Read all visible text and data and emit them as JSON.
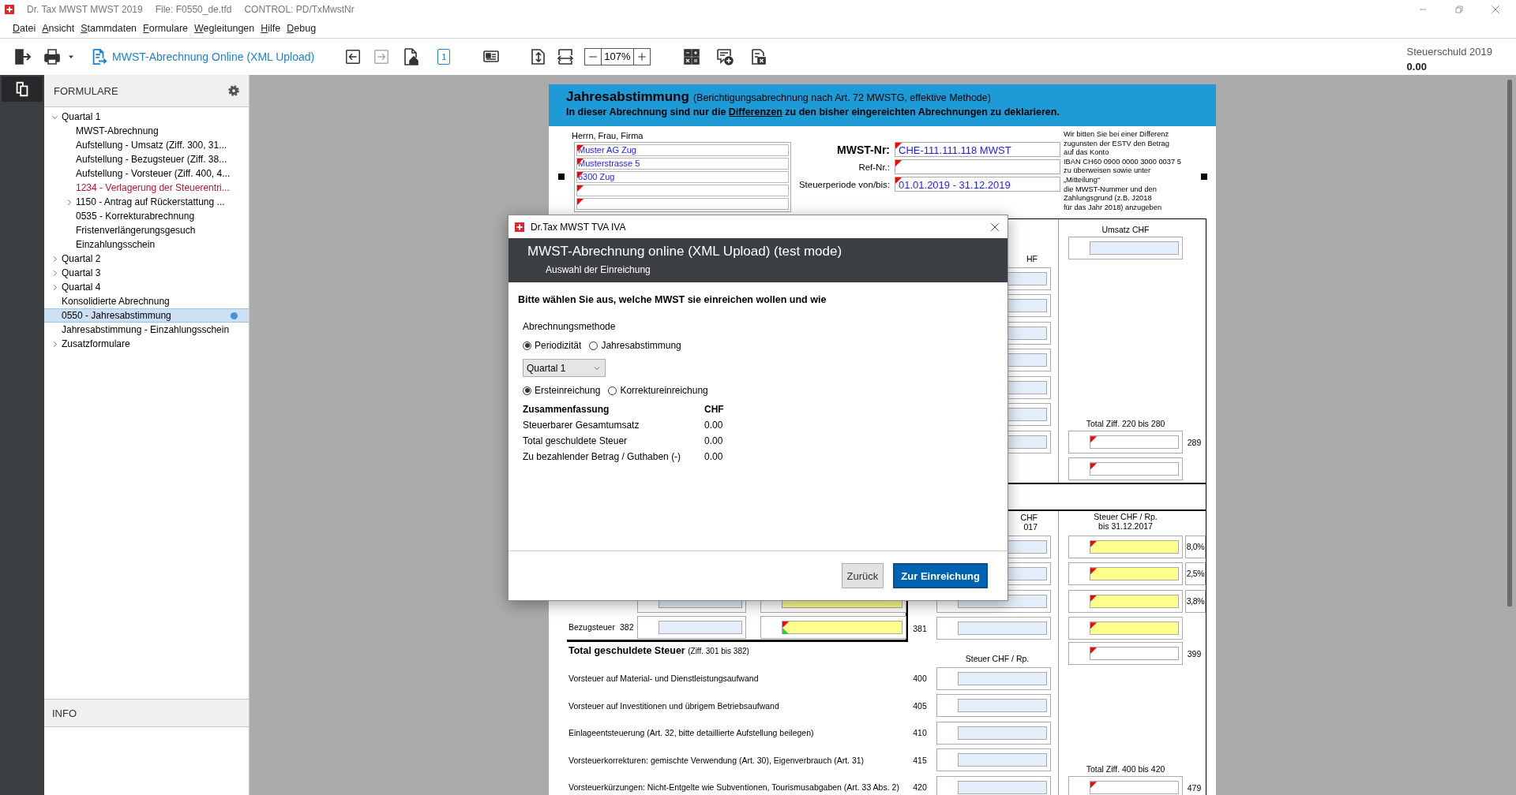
{
  "titlebar": {
    "app": "Dr. Tax MWST MWST 2019",
    "file": "File: F0550_de.tfd",
    "control": "CONTROL: PD/TxMwstNr"
  },
  "menu": [
    "Datei",
    "Ansicht",
    "Stammdaten",
    "Formulare",
    "Wegleitungen",
    "Hilfe",
    "Debug"
  ],
  "toolbar": {
    "upload_label": "MWST-Abrechnung Online (XML Upload)",
    "back_disabled": false,
    "forward_disabled": true,
    "page": "1",
    "zoom": "107%"
  },
  "tax_due": {
    "label": "Steuerschuld 2019",
    "value": "0.00"
  },
  "sidebar": {
    "title": "FORMULARE",
    "info_title": "INFO",
    "tree": [
      {
        "label": "Quartal 1",
        "expanded": true,
        "selected": false,
        "invalid": false,
        "marked": false,
        "children": [
          {
            "label": "MWST-Abrechnung",
            "selected": false,
            "invalid": false,
            "marked": false
          },
          {
            "label": "Aufstellung - Umsatz (Ziff. 300, 31...",
            "selected": false,
            "invalid": false,
            "marked": false
          },
          {
            "label": "Aufstellung - Bezugsteuer (Ziff. 38...",
            "selected": false,
            "invalid": false,
            "marked": false
          },
          {
            "label": "Aufstellung - Vorsteuer (Ziff. 400, 4...",
            "selected": false,
            "invalid": false,
            "marked": false
          },
          {
            "label": "1234 - Verlagerung der Steuerentri...",
            "selected": false,
            "invalid": true,
            "marked": false
          },
          {
            "label": "1150 - Antrag auf Rückerstattung ...",
            "expanded": false,
            "selected": false,
            "invalid": false,
            "marked": false
          },
          {
            "label": "0535 - Korrekturabrechnung",
            "selected": false,
            "invalid": false,
            "marked": false
          },
          {
            "label": "Fristenverlängerungsgesuch",
            "selected": false,
            "invalid": false,
            "marked": false
          },
          {
            "label": "Einzahlungsschein",
            "selected": false,
            "invalid": false,
            "marked": false
          }
        ]
      },
      {
        "label": "Quartal 2",
        "expanded": false,
        "selected": false,
        "invalid": false,
        "marked": false
      },
      {
        "label": "Quartal 3",
        "expanded": false,
        "selected": false,
        "invalid": false,
        "marked": false
      },
      {
        "label": "Quartal 4",
        "expanded": false,
        "selected": false,
        "invalid": false,
        "marked": false
      },
      {
        "label": "Konsolidierte Abrechnung",
        "selected": false,
        "invalid": false,
        "marked": false
      },
      {
        "label": "0550 - Jahresabstimmung",
        "selected": true,
        "invalid": false,
        "marked": true
      },
      {
        "label": "Jahresabstimmung - Einzahlungsschein",
        "selected": false,
        "invalid": false,
        "marked": false
      },
      {
        "label": "Zusatzformulare",
        "expanded": false,
        "selected": false,
        "invalid": false,
        "marked": false
      }
    ]
  },
  "document": {
    "title": "Jahresabstimmung",
    "subtitle": "(Berichtigungsabrechnung nach Art. 72 MWSTG, effektive Methode)",
    "notice": [
      "In dieser Abrechnung sind nur die ",
      "Differenzen",
      " zu den bisher eingereichten Abrechnungen zu deklarieren."
    ],
    "address_label": "Herrn, Frau, Firma",
    "address_fields": [
      {
        "value": "Muster AG Zug",
        "flagged": true
      },
      {
        "value": "Musterstrasse 5",
        "flagged": true
      },
      {
        "value": "6300 Zug",
        "flagged": true
      },
      {
        "flagged": true
      },
      {
        "flagged": true
      }
    ],
    "id_fields": [
      {
        "label": "MWST-Nr:",
        "strong": true,
        "value": "CHE-111.111.118 MWST",
        "flagged": true
      },
      {
        "label": "Ref-Nr.:",
        "strong": false,
        "flagged": true
      },
      {
        "label": "Steuerperiode von/bis:",
        "strong": false,
        "value": "01.01.2019 - 31.12.2019",
        "flagged": true
      }
    ],
    "payment_note": [
      "Wir bitten Sie bei einer Differenz",
      "zugunsten der ESTV den Betrag",
      "auf das Konto",
      "IBAN CH60 0900 0000 3000 0037 5",
      "zu überweisen sowie unter",
      "„Mitteilung“",
      "die MWST-Nummer und den",
      "Zahlungsgrund (z.B. J2018",
      "für das Jahr 2018) anzugeben"
    ],
    "sections": [
      {
        "rows": [
          {
            "mid_header": [
              "HF"
            ],
            "right_header": [
              "Umsatz CHF"
            ],
            "right": {
              "kind": "entry",
              "flagged": false
            }
          },
          {
            "mid": {
              "kind": "entry",
              "flagged": false
            }
          },
          {
            "mid": {
              "kind": "entry",
              "flagged": false
            }
          },
          {
            "mid": {
              "kind": "entry",
              "flagged": false
            }
          },
          {
            "mid": {
              "kind": "entry",
              "flagged": false
            }
          },
          {
            "mid": {
              "kind": "entry",
              "flagged": false
            }
          },
          {
            "mid": {
              "kind": "entry",
              "flagged": false
            }
          },
          {
            "mid": {
              "kind": "entry",
              "flagged": false
            },
            "right_header": [
              "Total Ziff. 220 bis 280"
            ],
            "right": {
              "kind": "total",
              "flagged": true
            },
            "rnum": "289"
          },
          {
            "right": {
              "kind": "total",
              "flagged": true
            }
          }
        ]
      },
      {
        "rows": [
          {
            "mid_header": [
              "CHF",
              "017"
            ],
            "right_header": [
              "Steuer CHF / Rp.",
              "bis 31.12.2017"
            ]
          },
          {
            "mid": {
              "kind": "entry",
              "flagged": false
            },
            "right": {
              "kind": "computed",
              "flagged": true
            },
            "pct": "8,0%"
          },
          {
            "mid": {
              "kind": "entry",
              "flagged": false
            },
            "right": {
              "kind": "computed",
              "flagged": true
            },
            "pct": "2,5%"
          },
          {
            "lfields": [
              {
                "kind": "entry",
                "flagged": false
              },
              {
                "kind": "computed",
                "flagged": false
              }
            ],
            "mid": {
              "kind": "entry",
              "flagged": false
            },
            "right": {
              "kind": "computed",
              "flagged": true
            },
            "pct": "3,8%"
          },
          {
            "label": "Bezugsteuer",
            "lnum": "382",
            "lfields": [
              {
                "kind": "entry",
                "flagged": false
              },
              {
                "kind": "computed",
                "flagged": true,
                "confirmed": true
              }
            ],
            "num": "381",
            "mid": {
              "kind": "entry",
              "flagged": false
            },
            "right": {
              "kind": "computed",
              "flagged": true
            }
          },
          {
            "label": "Total geschuldete Steuer",
            "note": "(Ziff. 301 bis 382)",
            "strong": true,
            "mid_header": [
              "Steuer CHF / Rp."
            ],
            "right": {
              "kind": "total",
              "flagged": true
            },
            "rnum": "399"
          },
          {
            "label": "Vorsteuer auf Material- und Dienstleistungsaufwand",
            "strong": false,
            "num": "400",
            "mid": {
              "kind": "entry",
              "flagged": false
            }
          },
          {
            "label": "Vorsteuer auf Investitionen und übrigem Betriebsaufwand",
            "strong": false,
            "num": "405",
            "mid": {
              "kind": "entry",
              "flagged": false
            }
          },
          {
            "label": "Einlageentsteuerung (Art. 32, bitte detaillierte Aufstellung beilegen)",
            "strong": false,
            "num": "410",
            "mid": {
              "kind": "entry",
              "flagged": false
            }
          },
          {
            "label": "Vorsteuerkorrekturen: gemischte Verwendung (Art. 30), Eigenverbrauch (Art. 31)",
            "strong": false,
            "num": "415",
            "mid": {
              "kind": "entry",
              "flagged": false
            }
          },
          {
            "label": "Vorsteuerkürzungen: Nicht-Entgelte wie Subventionen, Tourismusabgaben (Art. 33 Abs. 2)",
            "strong": false,
            "num": "420",
            "mid": {
              "kind": "entry",
              "flagged": false
            },
            "right_header": [
              "Total Ziff. 400 bis 420"
            ],
            "right": {
              "kind": "total",
              "flagged": true
            },
            "rnum": "479"
          }
        ]
      }
    ]
  },
  "dialog": {
    "window_title": "Dr.Tax MWST TVA IVA",
    "title": "MWST-Abrechnung online (XML Upload) (test mode)",
    "step": "Auswahl der Einreichung",
    "question": "Bitte wählen Sie aus, welche MWST sie einreichen wollen und wie",
    "method_label": "Abrechnungsmethode",
    "methods": [
      {
        "label": "Periodizität",
        "selected": true
      },
      {
        "label": "Jahresabstimmung",
        "selected": false
      }
    ],
    "period": "Quartal 1",
    "submission_types": [
      {
        "label": "Ersteinreichung",
        "selected": true
      },
      {
        "label": "Korrektureinreichung",
        "selected": false
      }
    ],
    "summary": {
      "heading": "Zusammenfassung",
      "currency": "CHF",
      "rows": [
        {
          "label": "Steuerbarer Gesamtumsatz",
          "value": "0.00"
        },
        {
          "label": "Total geschuldete Steuer",
          "value": "0.00"
        },
        {
          "label": "Zu bezahlender Betrag / Guthaben (-)",
          "value": "0.00"
        }
      ]
    },
    "buttons": [
      {
        "label": "Zurück",
        "kind": "secondary"
      },
      {
        "label": "Zur Einreichung",
        "kind": "primary"
      }
    ]
  }
}
